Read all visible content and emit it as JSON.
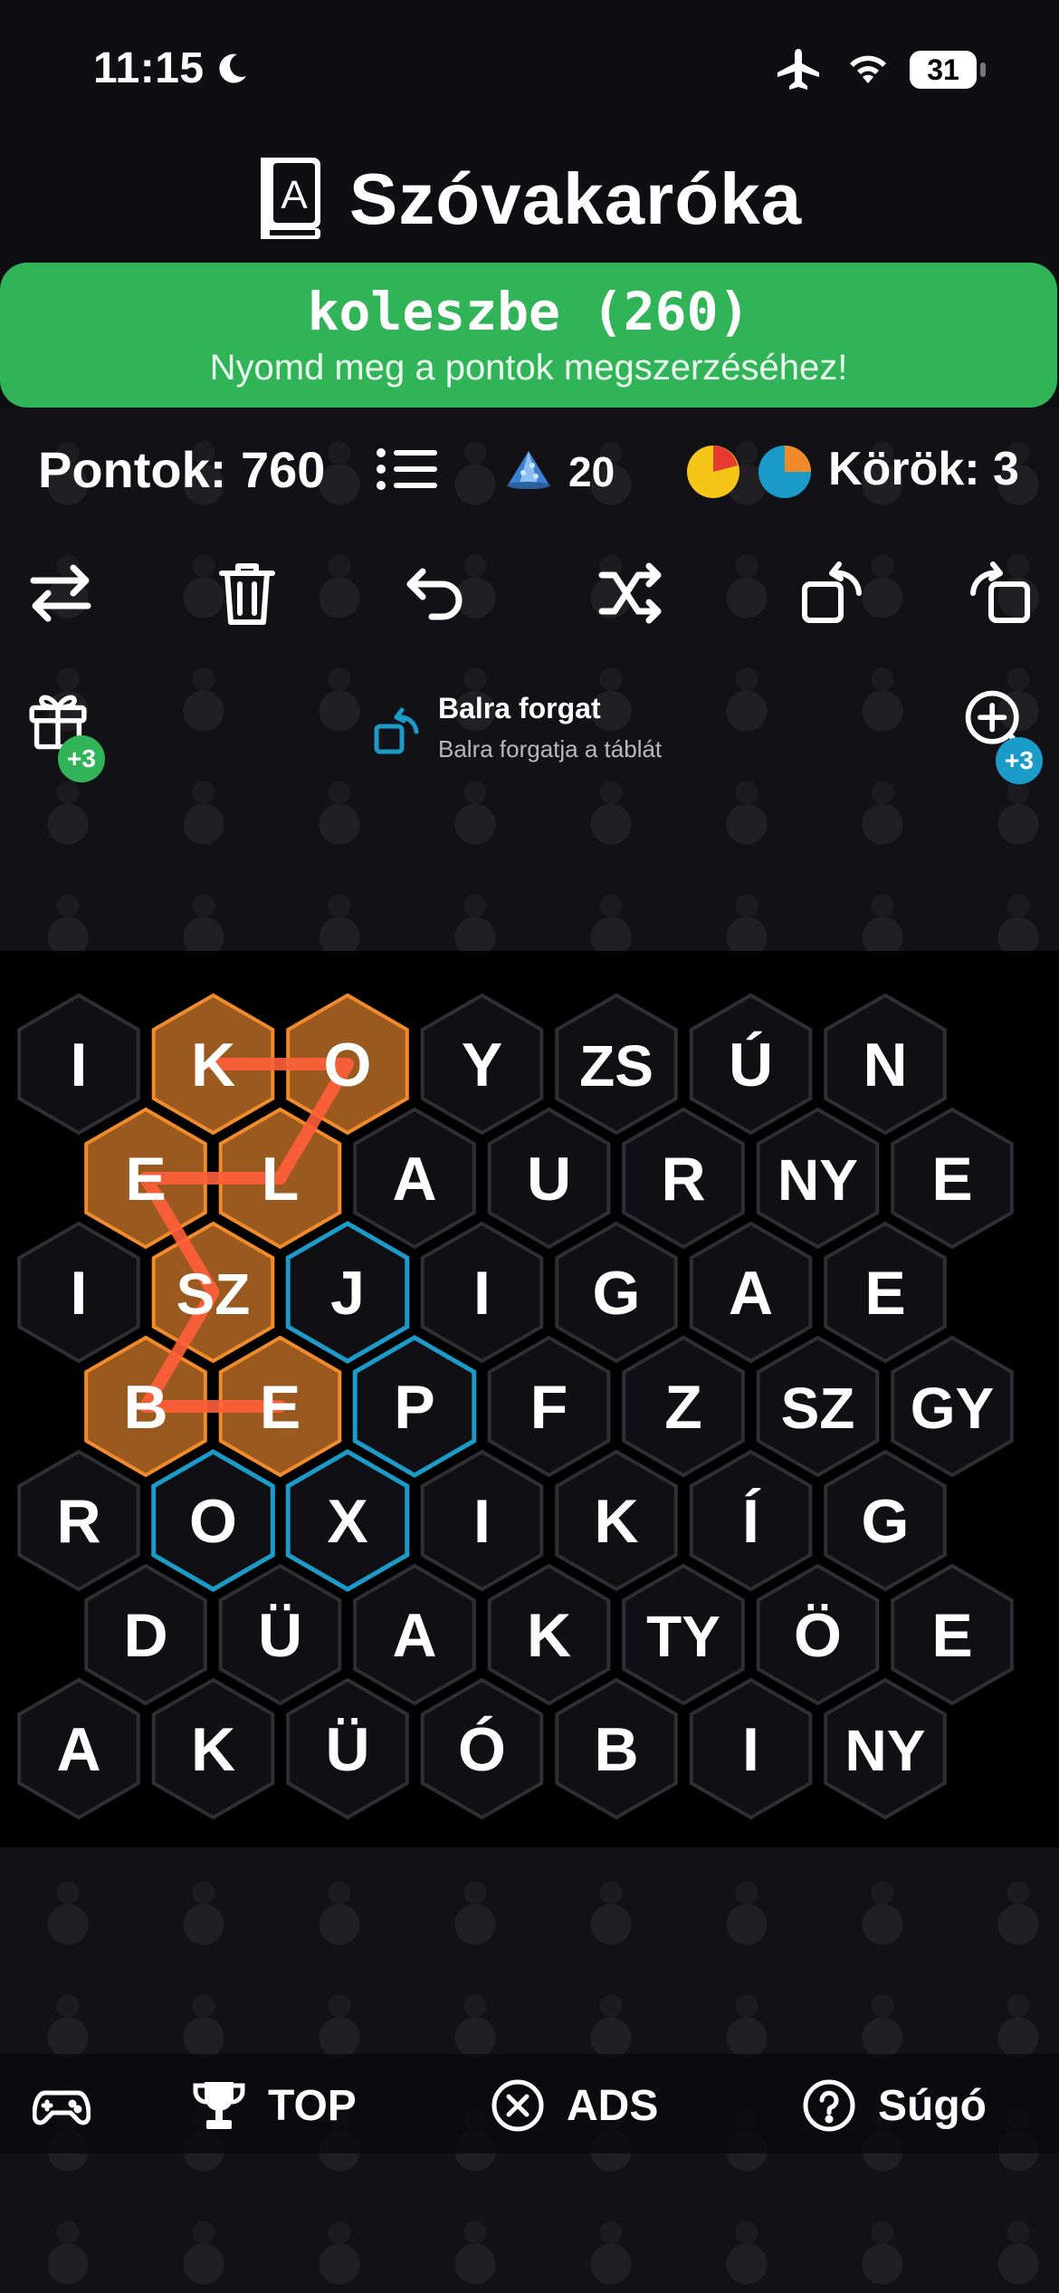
{
  "status_bar": {
    "time": "11:15",
    "battery": "31"
  },
  "header": {
    "title": "Szóvakaróka"
  },
  "banner": {
    "word": "koleszbe (260)",
    "hint": "Nyomd meg a pontok megszerzéséhez!"
  },
  "stats": {
    "score": "Pontok: 760",
    "gems": "20",
    "rounds": "Körök: 3"
  },
  "toolbar": {
    "items": [
      {
        "name": "swap-icon"
      },
      {
        "name": "trash-icon"
      },
      {
        "name": "undo-icon"
      },
      {
        "name": "shuffle-icon"
      },
      {
        "name": "rotate-left-icon"
      },
      {
        "name": "rotate-right-icon"
      }
    ]
  },
  "powerups": {
    "gift_badge": "+3",
    "zoom_badge": "+3",
    "tooltip_title": "Balra forgat",
    "tooltip_desc": "Balra forgatja a táblát"
  },
  "board": {
    "rows": [
      [
        "I",
        "K",
        "O",
        "Y",
        "ZS",
        "Ú",
        "N"
      ],
      [
        "E",
        "L",
        "A",
        "U",
        "R",
        "NY",
        "E"
      ],
      [
        "I",
        "SZ",
        "J",
        "I",
        "G",
        "A",
        "E"
      ],
      [
        "B",
        "E",
        "P",
        "F",
        "Z",
        "SZ",
        "GY"
      ],
      [
        "R",
        "O",
        "X",
        "I",
        "K",
        "Í",
        "G"
      ],
      [
        "D",
        "Ü",
        "A",
        "K",
        "TY",
        "Ö",
        "E"
      ],
      [
        "A",
        "K",
        "Ü",
        "Ó",
        "B",
        "I",
        "NY"
      ]
    ],
    "selected": [
      [
        0,
        1
      ],
      [
        0,
        2
      ],
      [
        1,
        0
      ],
      [
        1,
        1
      ],
      [
        2,
        1
      ],
      [
        3,
        0
      ],
      [
        3,
        1
      ]
    ],
    "highlighted": [
      [
        2,
        2
      ],
      [
        3,
        2
      ],
      [
        4,
        1
      ],
      [
        4,
        2
      ]
    ],
    "path": [
      [
        0,
        1
      ],
      [
        0,
        2
      ],
      [
        1,
        1
      ],
      [
        1,
        0
      ],
      [
        2,
        1
      ],
      [
        3,
        0
      ],
      [
        3,
        1
      ]
    ],
    "colors": {
      "selected": "#9a5a1f",
      "selected_border": "#f08a2a",
      "highlighted_border": "#1a9bc9",
      "path": "#ff5e3a",
      "cell": "#101014",
      "cell_border": "#2e2e34"
    }
  },
  "bottom_nav": {
    "items": [
      {
        "label": "",
        "icon": "gamepad-icon"
      },
      {
        "label": "TOP",
        "icon": "trophy-icon"
      },
      {
        "label": "ADS",
        "icon": "close-circle-icon"
      },
      {
        "label": "Súgó",
        "icon": "help-circle-icon"
      }
    ]
  }
}
